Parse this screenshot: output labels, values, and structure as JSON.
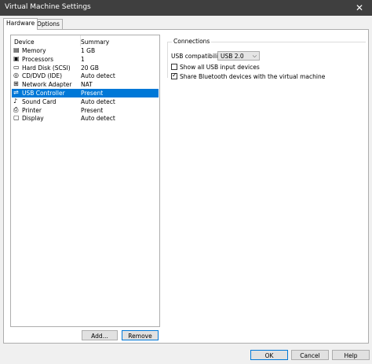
{
  "window": {
    "title": "Virtual Machine Settings",
    "close_glyph": "✕"
  },
  "tabs": [
    {
      "label": "Hardware"
    },
    {
      "label": "Options"
    }
  ],
  "device_list": {
    "columns": {
      "device": "Device",
      "summary": "Summary"
    },
    "rows": [
      {
        "icon": "memory-icon",
        "device": "Memory",
        "summary": "1 GB"
      },
      {
        "icon": "processor-icon",
        "device": "Processors",
        "summary": "1"
      },
      {
        "icon": "hard-disk-icon",
        "device": "Hard Disk (SCSI)",
        "summary": "20 GB"
      },
      {
        "icon": "cd-dvd-icon",
        "device": "CD/DVD (IDE)",
        "summary": "Auto detect"
      },
      {
        "icon": "network-adapter-icon",
        "device": "Network Adapter",
        "summary": "NAT"
      },
      {
        "icon": "usb-controller-icon",
        "device": "USB Controller",
        "summary": "Present"
      },
      {
        "icon": "sound-card-icon",
        "device": "Sound Card",
        "summary": "Auto detect"
      },
      {
        "icon": "printer-icon",
        "device": "Printer",
        "summary": "Present"
      },
      {
        "icon": "display-icon",
        "device": "Display",
        "summary": "Auto detect"
      }
    ],
    "selected_index": 5,
    "selected_color": "#0078d7"
  },
  "buttons": {
    "add": "Add...",
    "remove": "Remove",
    "ok": "OK",
    "cancel": "Cancel",
    "help": "Help"
  },
  "connections": {
    "group_label": "Connections",
    "usb_compat_label": "USB compatibility:",
    "usb_compat_value": "USB 2.0",
    "show_all_usb": {
      "label": "Show all USB input devices",
      "checked": false
    },
    "share_bluetooth": {
      "label": "Share Bluetooth devices with the virtual machine",
      "checked": true
    }
  }
}
